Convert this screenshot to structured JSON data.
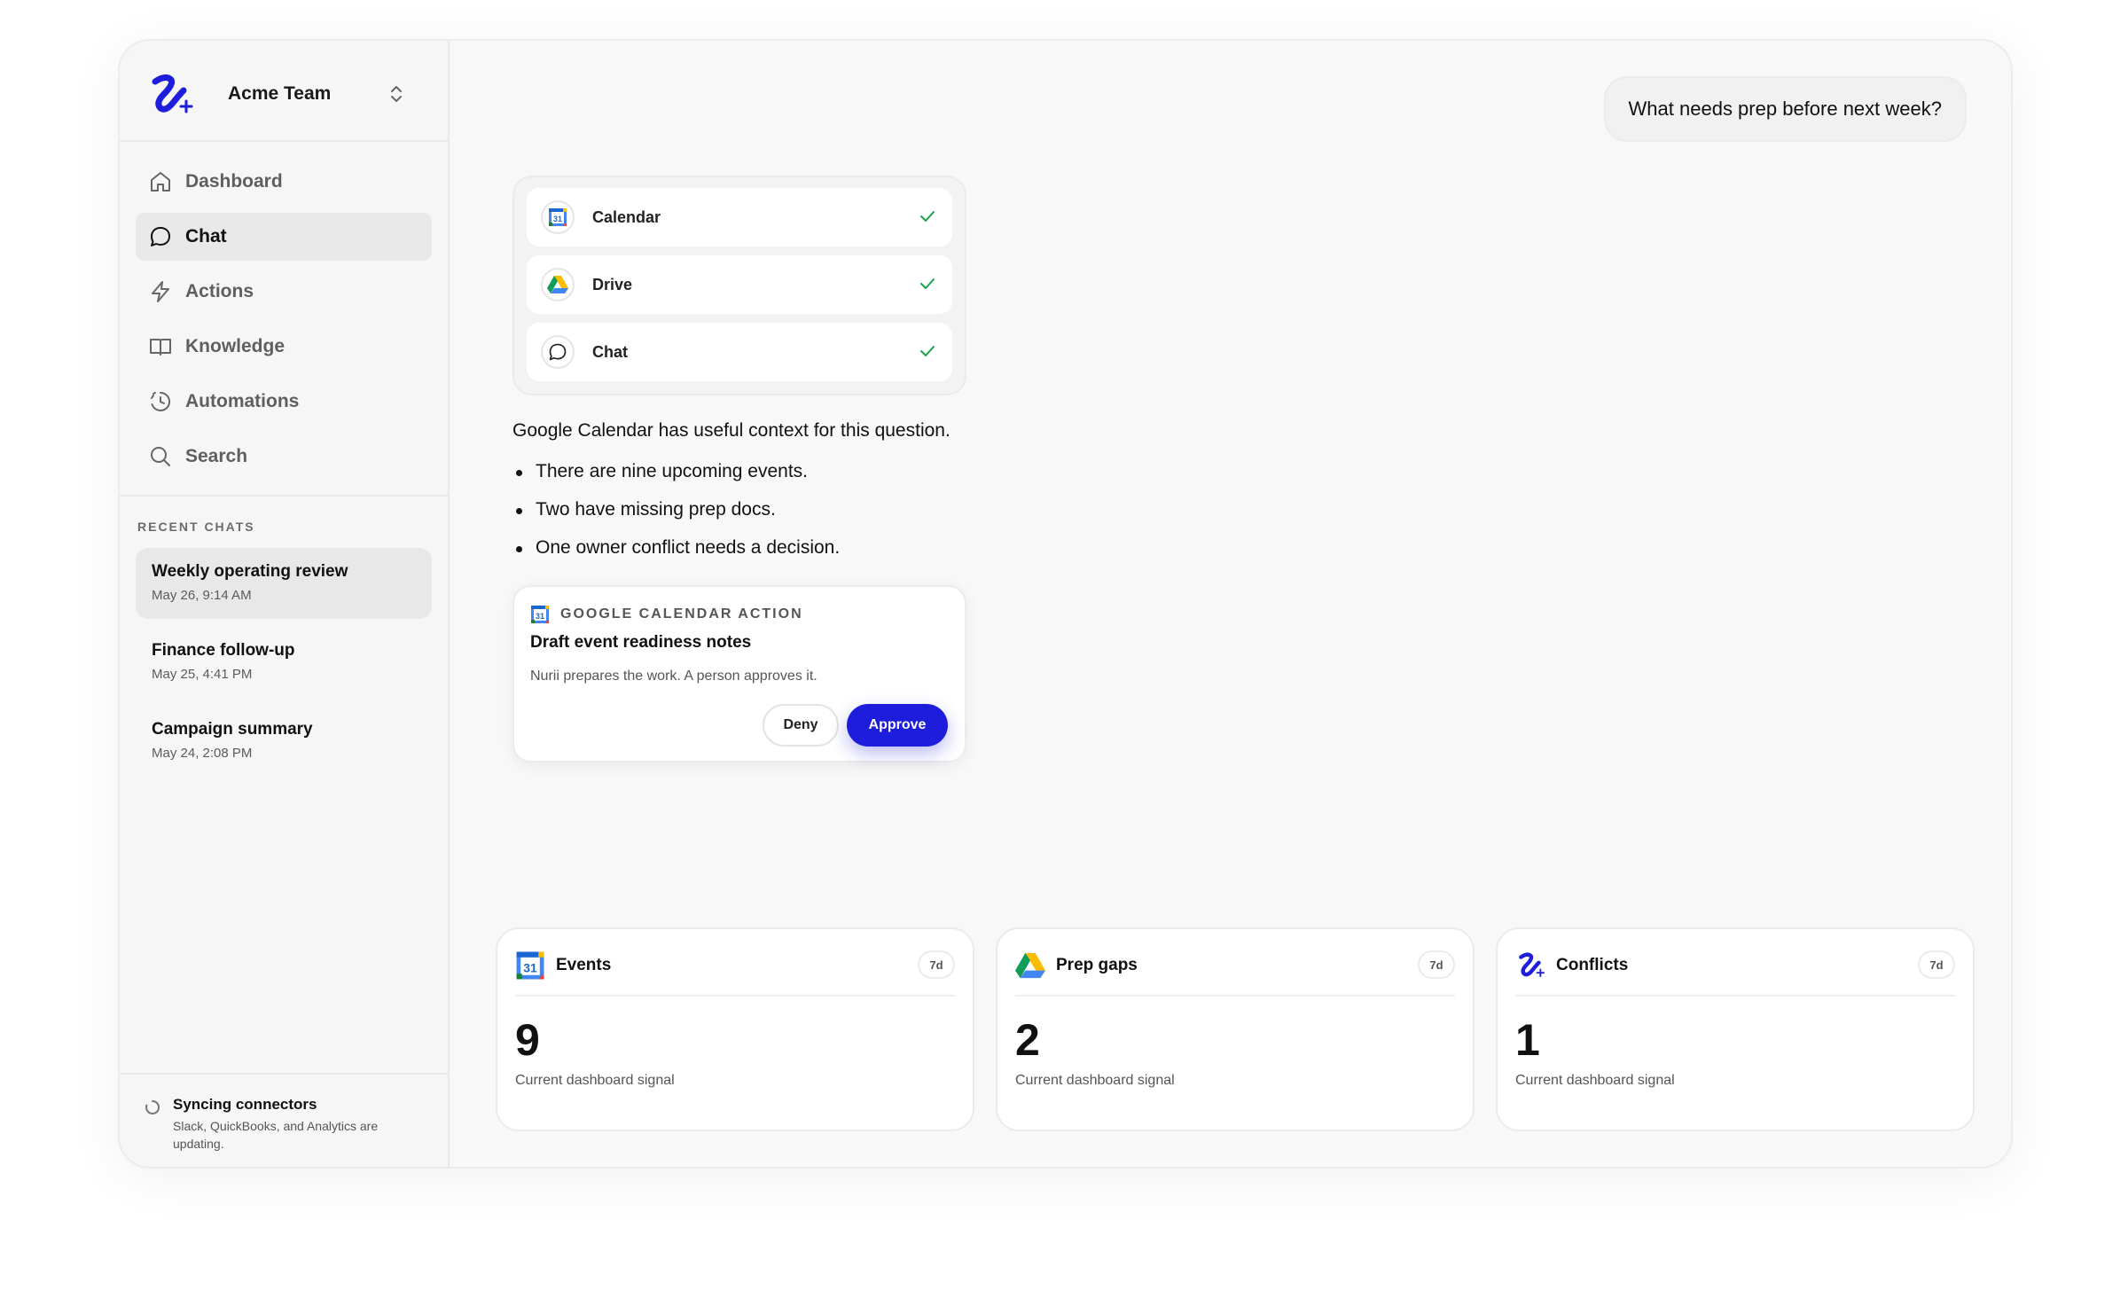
{
  "colors": {
    "accent": "#1d1ddb",
    "check": "#1aa34a",
    "background": "#f8f8f8"
  },
  "team": {
    "name": "Acme Team"
  },
  "nav": [
    {
      "label": "Dashboard",
      "icon": "home-icon",
      "active": false
    },
    {
      "label": "Chat",
      "icon": "chat-bubble-icon",
      "active": true
    },
    {
      "label": "Actions",
      "icon": "lightning-icon",
      "active": false
    },
    {
      "label": "Knowledge",
      "icon": "book-icon",
      "active": false
    },
    {
      "label": "Automations",
      "icon": "clock-history-icon",
      "active": false
    },
    {
      "label": "Search",
      "icon": "search-icon",
      "active": false
    }
  ],
  "recent": {
    "title": "RECENT CHATS",
    "items": [
      {
        "title": "Weekly operating review",
        "date": "May 26, 9:14 AM",
        "active": true
      },
      {
        "title": "Finance follow-up",
        "date": "May 25, 4:41 PM",
        "active": false
      },
      {
        "title": "Campaign summary",
        "date": "May 24, 2:08 PM",
        "active": false
      }
    ]
  },
  "sync": {
    "title": "Syncing connectors",
    "description": "Slack, QuickBooks, and Analytics are updating."
  },
  "chat": {
    "user_message": "What needs prep before next week?",
    "sources": [
      {
        "label": "Calendar",
        "icon": "google-calendar-icon",
        "checked": true
      },
      {
        "label": "Drive",
        "icon": "google-drive-icon",
        "checked": true
      },
      {
        "label": "Chat",
        "icon": "chat-bubble-icon",
        "checked": true
      }
    ],
    "answer_intro": "Google Calendar has useful context for this question.",
    "answer_points": [
      "There are nine upcoming events.",
      "Two have missing prep docs.",
      "One owner conflict needs a decision."
    ],
    "action": {
      "eyebrow": "GOOGLE CALENDAR ACTION",
      "title": "Draft event readiness notes",
      "description": "Nurii prepares the work. A person approves it.",
      "deny_label": "Deny",
      "approve_label": "Approve"
    }
  },
  "stats": [
    {
      "title": "Events",
      "icon": "google-calendar-icon",
      "badge": "7d",
      "value": "9",
      "caption": "Current dashboard signal"
    },
    {
      "title": "Prep gaps",
      "icon": "google-drive-icon",
      "badge": "7d",
      "value": "2",
      "caption": "Current dashboard signal"
    },
    {
      "title": "Conflicts",
      "icon": "brand-logo-icon",
      "badge": "7d",
      "value": "1",
      "caption": "Current dashboard signal"
    }
  ]
}
